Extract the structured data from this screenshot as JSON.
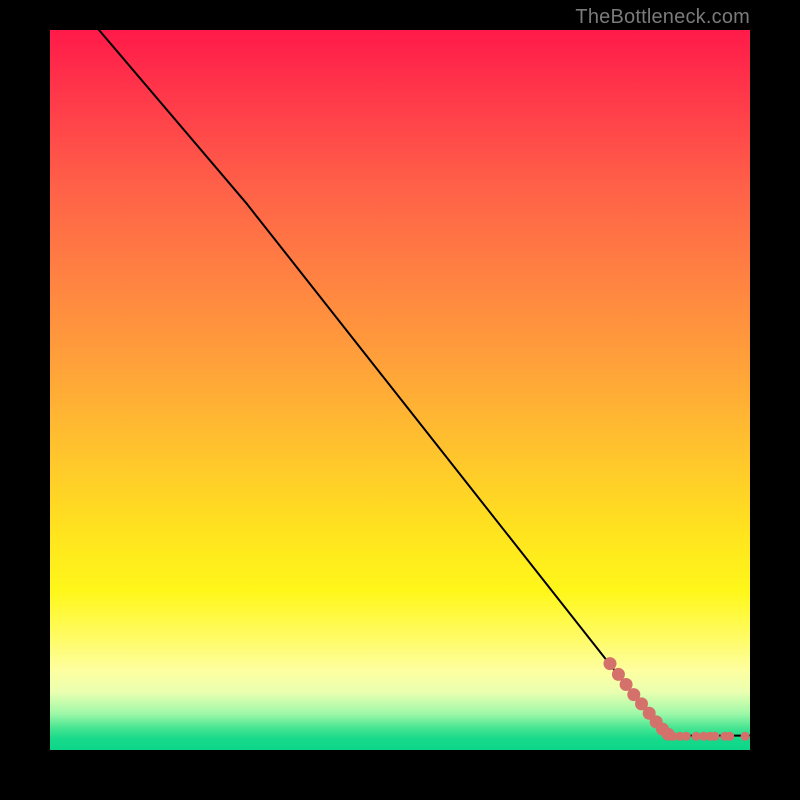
{
  "attribution": "TheBottleneck.com",
  "chart_data": {
    "type": "line",
    "title": "",
    "xlabel": "",
    "ylabel": "",
    "xlim": [
      0,
      100
    ],
    "ylim": [
      0,
      100
    ],
    "grid": false,
    "legend": false,
    "series": [
      {
        "name": "curve",
        "kind": "line",
        "color": "#000000",
        "x": [
          7,
          28,
          88,
          100
        ],
        "y": [
          100,
          76,
          2,
          2
        ]
      },
      {
        "name": "data-points",
        "kind": "scatter",
        "color": "#d4716b",
        "points": [
          {
            "x": 80.0,
            "y": 12.0,
            "size": "big"
          },
          {
            "x": 81.2,
            "y": 10.5,
            "size": "big"
          },
          {
            "x": 82.3,
            "y": 9.1,
            "size": "big"
          },
          {
            "x": 83.4,
            "y": 7.7,
            "size": "big"
          },
          {
            "x": 84.5,
            "y": 6.4,
            "size": "big"
          },
          {
            "x": 85.6,
            "y": 5.1,
            "size": "big"
          },
          {
            "x": 86.6,
            "y": 3.9,
            "size": "big"
          },
          {
            "x": 87.5,
            "y": 2.9,
            "size": "big"
          },
          {
            "x": 88.3,
            "y": 2.2,
            "size": "big"
          },
          {
            "x": 89.0,
            "y": 1.9,
            "size": "sm"
          },
          {
            "x": 90.0,
            "y": 1.9,
            "size": "sm"
          },
          {
            "x": 90.9,
            "y": 1.9,
            "size": "sm"
          },
          {
            "x": 92.3,
            "y": 1.9,
            "size": "sm"
          },
          {
            "x": 93.4,
            "y": 1.9,
            "size": "sm"
          },
          {
            "x": 94.3,
            "y": 1.9,
            "size": "sm"
          },
          {
            "x": 95.0,
            "y": 1.9,
            "size": "sm"
          },
          {
            "x": 96.4,
            "y": 1.9,
            "size": "sm"
          },
          {
            "x": 97.1,
            "y": 1.9,
            "size": "sm"
          },
          {
            "x": 99.3,
            "y": 1.9,
            "size": "sm"
          }
        ]
      }
    ],
    "background_gradient": {
      "direction": "vertical",
      "stops": [
        {
          "pos": 0.0,
          "color": "#ff1a49"
        },
        {
          "pos": 0.7,
          "color": "#ffe41e"
        },
        {
          "pos": 0.9,
          "color": "#feffa0"
        },
        {
          "pos": 1.0,
          "color": "#0dd689"
        }
      ]
    }
  }
}
